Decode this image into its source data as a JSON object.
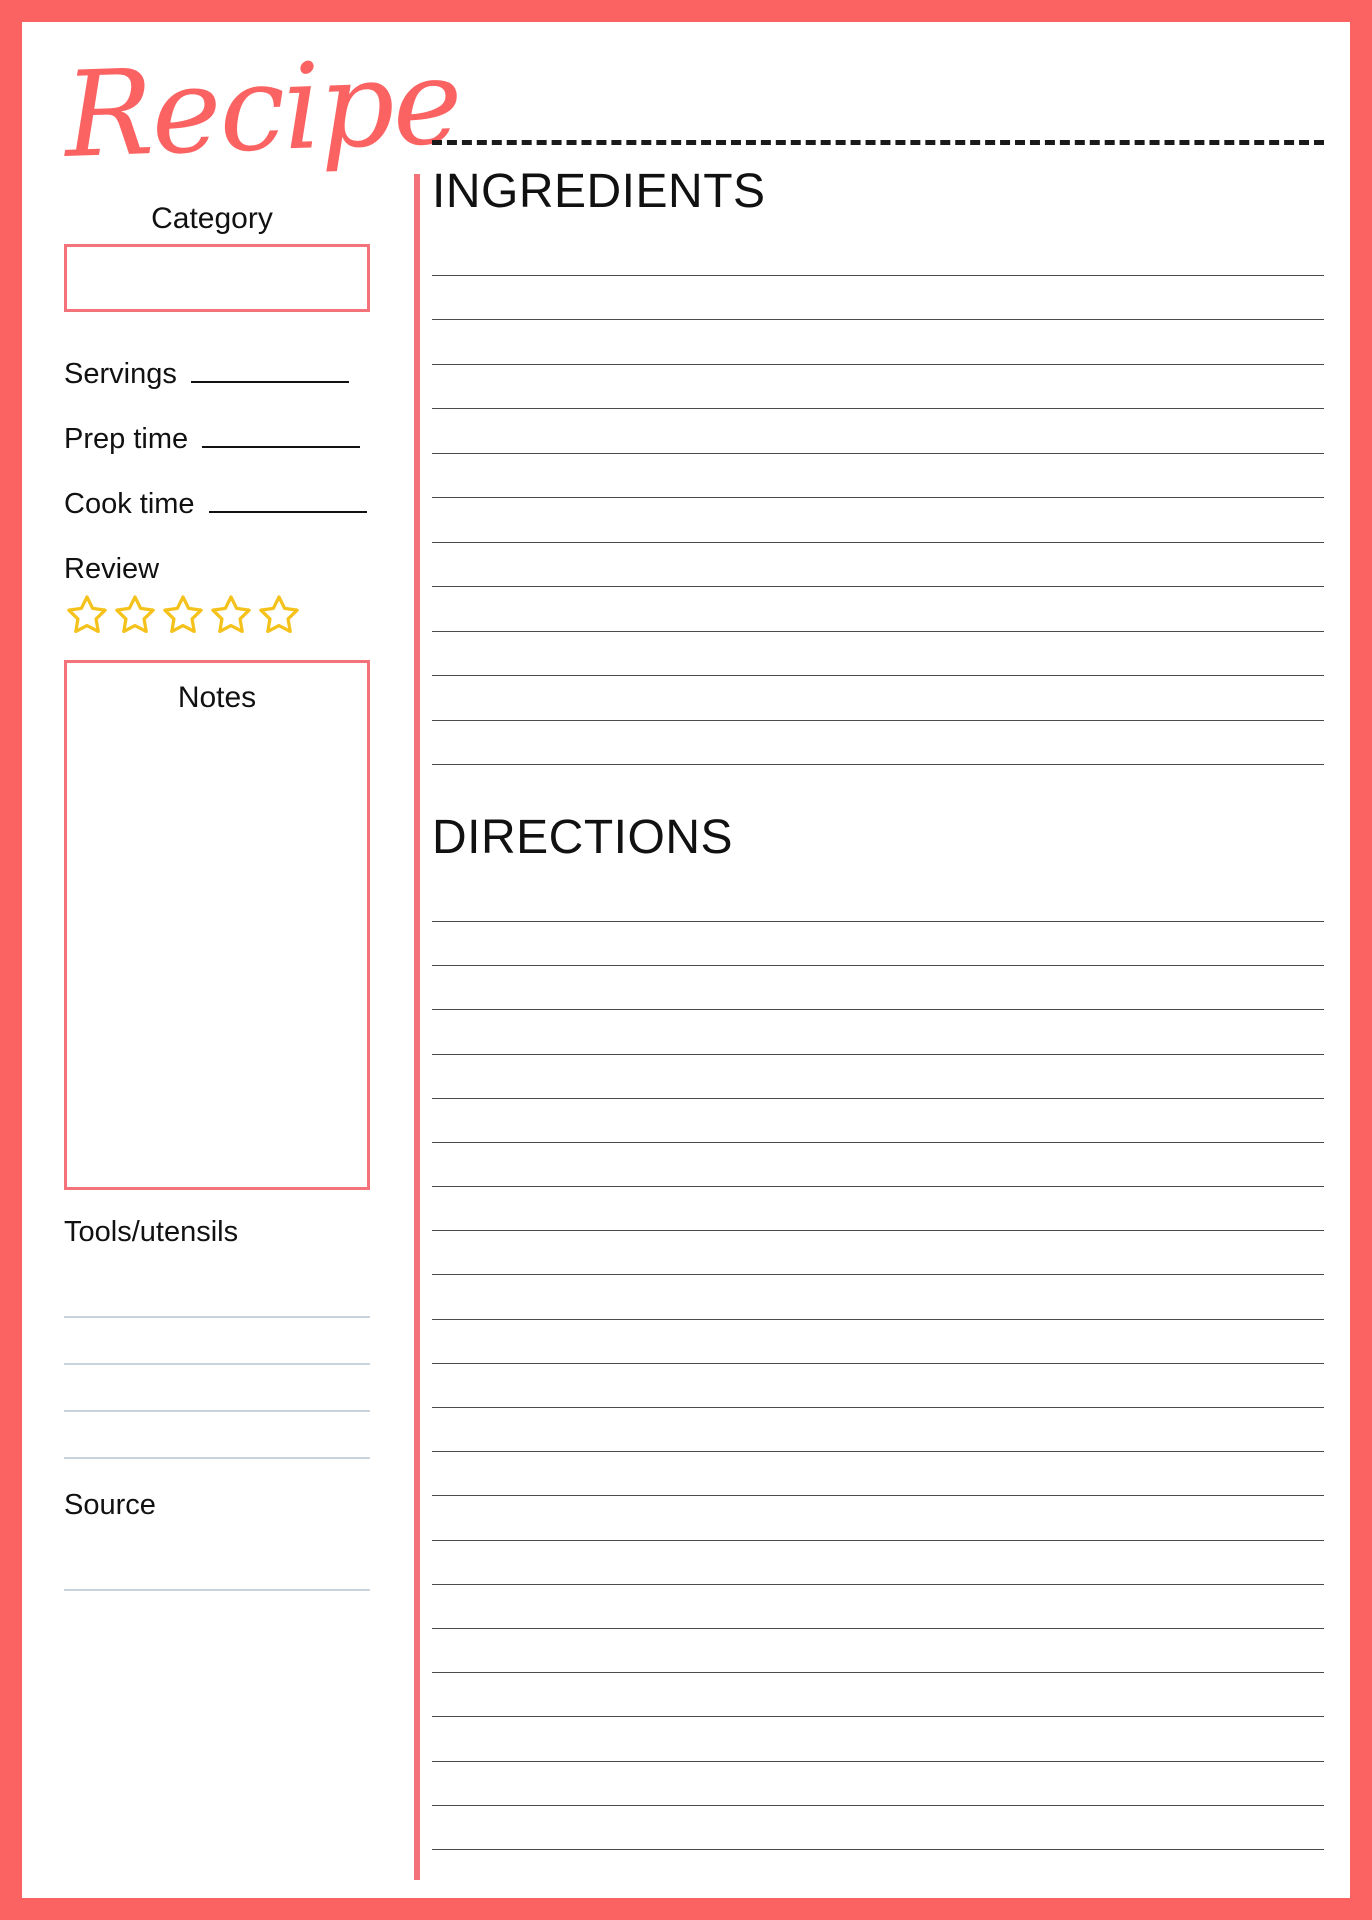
{
  "theme": {
    "frame_color": "#FB6363",
    "accent_color": "#F4727A",
    "star_color": "#F5C21B",
    "rule_color": "#4a4a4a",
    "soft_rule_color": "#C9D3DC",
    "text_color": "#111111"
  },
  "header": {
    "title": "Recipe"
  },
  "sidebar": {
    "category": {
      "label": "Category",
      "value": ""
    },
    "meta": [
      {
        "label": "Servings",
        "value": ""
      },
      {
        "label": "Prep time",
        "value": ""
      },
      {
        "label": "Cook time",
        "value": ""
      }
    ],
    "review": {
      "label": "Review",
      "star_count": 5,
      "filled": 0,
      "icon": "star-outline-icon"
    },
    "notes": {
      "label": "Notes",
      "value": ""
    },
    "tools": {
      "label": "Tools/utensils",
      "line_count": 4,
      "values": [
        "",
        "",
        "",
        ""
      ]
    },
    "source": {
      "label": "Source",
      "line_count": 1,
      "values": [
        ""
      ]
    }
  },
  "main": {
    "ingredients": {
      "heading": "INGREDIENTS",
      "line_count": 12,
      "values": [
        "",
        "",
        "",
        "",
        "",
        "",
        "",
        "",
        "",
        "",
        "",
        ""
      ]
    },
    "directions": {
      "heading": "DIRECTIONS",
      "line_count": 22,
      "values": [
        "",
        "",
        "",
        "",
        "",
        "",
        "",
        "",
        "",
        "",
        "",
        "",
        "",
        "",
        "",
        "",
        "",
        "",
        "",
        "",
        "",
        ""
      ]
    }
  }
}
